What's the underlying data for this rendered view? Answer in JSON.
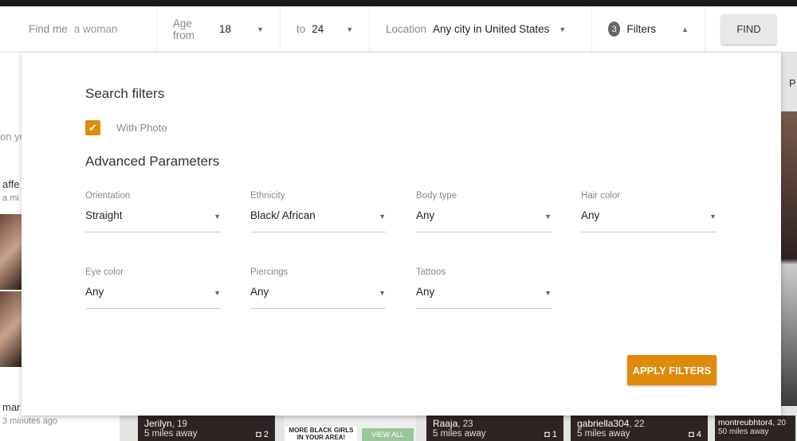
{
  "header": {
    "find_me_label": "Find me",
    "find_me_value": "a woman",
    "age_from_label": "Age from",
    "age_from": "18",
    "age_to_label": "to",
    "age_to": "24",
    "location_label": "Location",
    "location": "Any city in United States",
    "filter_count": "3",
    "filters_label": "Filters",
    "find_button": "FIND"
  },
  "sidebar": {
    "snippets": [
      "on yo",
      "affe",
      "a mi",
      "mar",
      "3 minutes ago"
    ]
  },
  "right_edge": {
    "text": "P"
  },
  "panel": {
    "title": "Search filters",
    "with_photo": "With Photo",
    "with_photo_checked": true,
    "advanced_title": "Advanced Parameters",
    "fields": [
      {
        "label": "Orientation",
        "value": "Straight"
      },
      {
        "label": "Ethnicity",
        "value": "Black/ African"
      },
      {
        "label": "Body type",
        "value": "Any"
      },
      {
        "label": "Hair color",
        "value": "Any"
      },
      {
        "label": "Eye color",
        "value": "Any"
      },
      {
        "label": "Piercings",
        "value": "Any"
      },
      {
        "label": "Tattoos",
        "value": "Any"
      }
    ],
    "apply_button": "APPLY FILTERS"
  },
  "cards": [
    {
      "name": "Jerilyn",
      "age": ", 19",
      "distance": "5 miles away",
      "photos": "2"
    },
    {
      "name": "Raaja",
      "age": ", 23",
      "distance": "5 miles away",
      "photos": "1"
    },
    {
      "name": "gabriella304",
      "age": ", 22",
      "distance": "5 miles away",
      "photos": "4"
    },
    {
      "name": "montreubhtor4",
      "age": ", 20",
      "distance": "50 miles away",
      "photos": ""
    }
  ],
  "ad": {
    "text": "MORE BLACK GIRLS IN YOUR AREA!",
    "button": "VIEW ALL"
  },
  "colors": {
    "accent": "#e08a0c"
  }
}
